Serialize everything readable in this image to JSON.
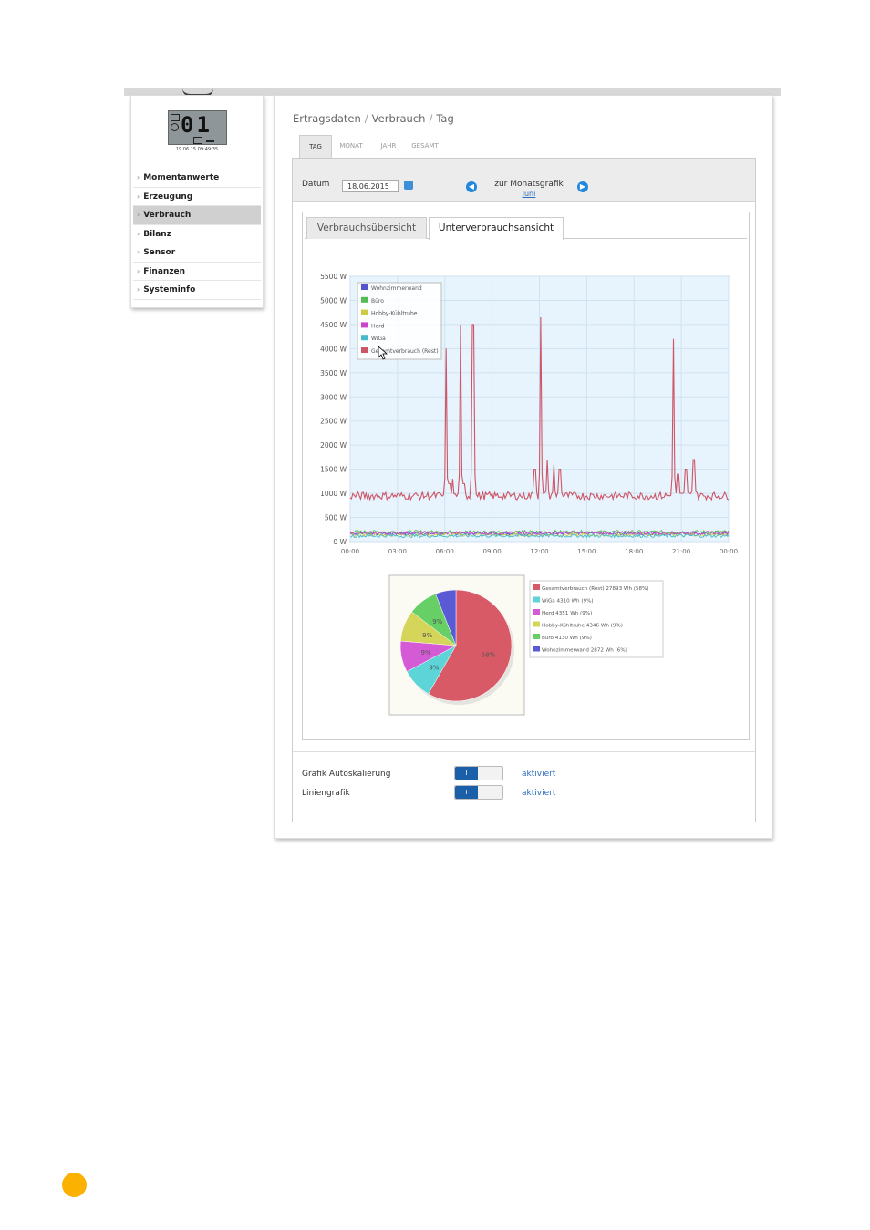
{
  "sidebar": {
    "lcd_digits": "01",
    "lcd_time": "19.06.15 09:49:35",
    "items": [
      {
        "label": "Momentanwerte",
        "active": false
      },
      {
        "label": "Erzeugung",
        "active": false
      },
      {
        "label": "Verbrauch",
        "active": true
      },
      {
        "label": "Bilanz",
        "active": false
      },
      {
        "label": "Sensor",
        "active": false
      },
      {
        "label": "Finanzen",
        "active": false
      },
      {
        "label": "Systeminfo",
        "active": false
      }
    ]
  },
  "breadcrumb": {
    "part1": "Ertragsdaten",
    "part2": "Verbrauch",
    "part3": "Tag",
    "sep": "/"
  },
  "period_tabs": [
    "TAG",
    "MONAT",
    "JAHR",
    "GESAMT"
  ],
  "datebar": {
    "date_label": "Datum",
    "date_value": "18.06.2015",
    "month_label": "zur Monatsgrafik",
    "month_link": "Juni",
    "prev_icon": "chevron-left-icon",
    "next_icon": "chevron-right-icon"
  },
  "view_tabs": {
    "overview": "Verbrauchsübersicht",
    "detail": "Unterverbrauchsansicht"
  },
  "controls": {
    "autoscale_label": "Grafik Autoskalierung",
    "autoscale_value": "aktiviert",
    "line_label": "Liniengrafik",
    "line_value": "aktiviert",
    "toggle_on_text": "I"
  },
  "chart_data": [
    {
      "type": "line",
      "x_ticks": [
        "00:00",
        "03:00",
        "06:00",
        "09:00",
        "12:00",
        "15:00",
        "18:00",
        "21:00",
        "00:00"
      ],
      "y_ticks": [
        "0 W",
        "500 W",
        "1000 W",
        "1500 W",
        "2000 W",
        "2500 W",
        "3000 W",
        "3500 W",
        "4000 W",
        "4500 W",
        "5000 W",
        "5500 W"
      ],
      "ylim": [
        0,
        5500
      ],
      "xlim_hours": [
        0,
        24
      ],
      "grid": true,
      "legend_position": "top-left",
      "series": [
        {
          "name": "Wohnzimmerwand",
          "color": "#5555cc",
          "base": 170
        },
        {
          "name": "Büro",
          "color": "#55bb55",
          "base": 200
        },
        {
          "name": "Hobby-Kühltruhe",
          "color": "#cccc44",
          "base": 140
        },
        {
          "name": "Herd",
          "color": "#cc44cc",
          "base": 180
        },
        {
          "name": "WiGa",
          "color": "#44bbcc",
          "base": 120
        },
        {
          "name": "Gesamtverbrauch (Rest)",
          "color": "#cc5566",
          "base": 950,
          "spikes": [
            {
              "h": 6.1,
              "v": 4000
            },
            {
              "h": 6.3,
              "v": 1200
            },
            {
              "h": 6.5,
              "v": 1300
            },
            {
              "h": 7.0,
              "v": 4500
            },
            {
              "h": 7.2,
              "v": 1200
            },
            {
              "h": 7.8,
              "v": 4500
            },
            {
              "h": 11.7,
              "v": 1500
            },
            {
              "h": 12.1,
              "v": 4650
            },
            {
              "h": 12.5,
              "v": 1700
            },
            {
              "h": 12.9,
              "v": 1600
            },
            {
              "h": 13.3,
              "v": 1500
            },
            {
              "h": 20.5,
              "v": 4200
            },
            {
              "h": 20.8,
              "v": 1400
            },
            {
              "h": 21.3,
              "v": 1500
            },
            {
              "h": 21.8,
              "v": 1700
            }
          ]
        }
      ]
    },
    {
      "type": "pie",
      "slices": [
        {
          "name": "Gesamtverbrauch (Rest)",
          "label": "Gesamtverbrauch (Rest) 27893 Wh (58%)",
          "value": 27893,
          "pct": "58%",
          "color": "#d85a66"
        },
        {
          "name": "WiGa",
          "label": "WiGa 4310 Wh (9%)",
          "value": 4310,
          "pct": "9%",
          "color": "#5dd5d8"
        },
        {
          "name": "Herd",
          "label": "Herd 4351 Wh (9%)",
          "value": 4351,
          "pct": "9%",
          "color": "#d55ad5"
        },
        {
          "name": "Hobby-Kühltruhe",
          "label": "Hobby-Kühltruhe 4346 Wh (9%)",
          "value": 4346,
          "pct": "9%",
          "color": "#d5d55a"
        },
        {
          "name": "Büro",
          "label": "Büro 4130 Wh (9%)",
          "value": 4130,
          "pct": "9%",
          "color": "#66d066"
        },
        {
          "name": "Wohnzimmerwand",
          "label": "Wohnzimmerwand 2872 Wh (6%)",
          "value": 2872,
          "pct": "6%",
          "color": "#5a5ad5"
        }
      ]
    }
  ]
}
